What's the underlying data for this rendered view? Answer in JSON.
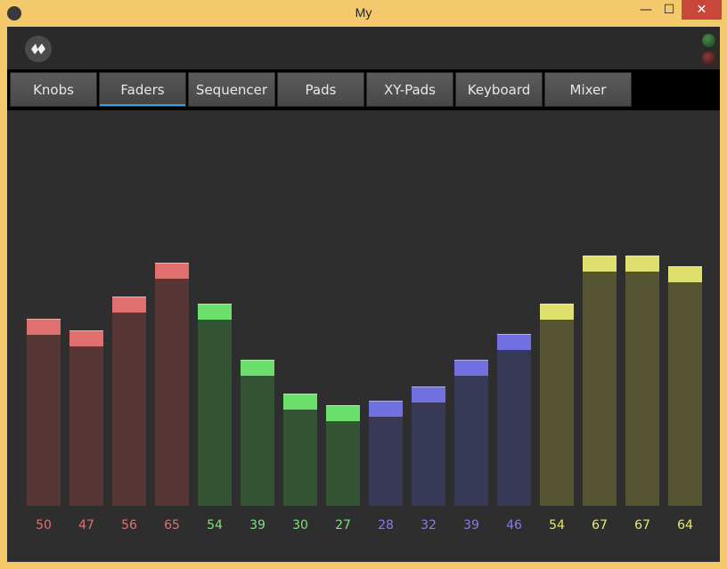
{
  "window": {
    "title": "My",
    "minimize_glyph": "—",
    "maximize_glyph": "☐",
    "close_glyph": "✕"
  },
  "actionbar": {
    "logo_icon": "kivy-logo-icon"
  },
  "tabs": [
    {
      "label": "Knobs",
      "active": false
    },
    {
      "label": "Faders",
      "active": true
    },
    {
      "label": "Sequencer",
      "active": false
    },
    {
      "label": "Pads",
      "active": false
    },
    {
      "label": "XY-Pads",
      "active": false
    },
    {
      "label": "Keyboard",
      "active": false
    },
    {
      "label": "Mixer",
      "active": false
    }
  ],
  "colors": {
    "accent": "#33a4d8",
    "red_cap": "#e07070",
    "red_fill": "#573636",
    "red_text": "#e07070",
    "green_cap": "#6ddf6d",
    "green_fill": "#335533",
    "green_text": "#7ee07e",
    "blue_cap": "#7070e0",
    "blue_fill": "#383857",
    "blue_text": "#8080e8",
    "yellow_cap": "#dfdf6d",
    "yellow_fill": "#555533",
    "yellow_text": "#e8e870"
  },
  "faders": {
    "max": 100,
    "items": [
      {
        "value": "50",
        "group": "red"
      },
      {
        "value": "47",
        "group": "red"
      },
      {
        "value": "56",
        "group": "red"
      },
      {
        "value": "65",
        "group": "red"
      },
      {
        "value": "54",
        "group": "green"
      },
      {
        "value": "39",
        "group": "green"
      },
      {
        "value": "30",
        "group": "green"
      },
      {
        "value": "27",
        "group": "green"
      },
      {
        "value": "28",
        "group": "blue"
      },
      {
        "value": "32",
        "group": "blue"
      },
      {
        "value": "39",
        "group": "blue"
      },
      {
        "value": "46",
        "group": "blue"
      },
      {
        "value": "54",
        "group": "yellow"
      },
      {
        "value": "67",
        "group": "yellow"
      },
      {
        "value": "67",
        "group": "yellow"
      },
      {
        "value": "64",
        "group": "yellow"
      }
    ]
  }
}
